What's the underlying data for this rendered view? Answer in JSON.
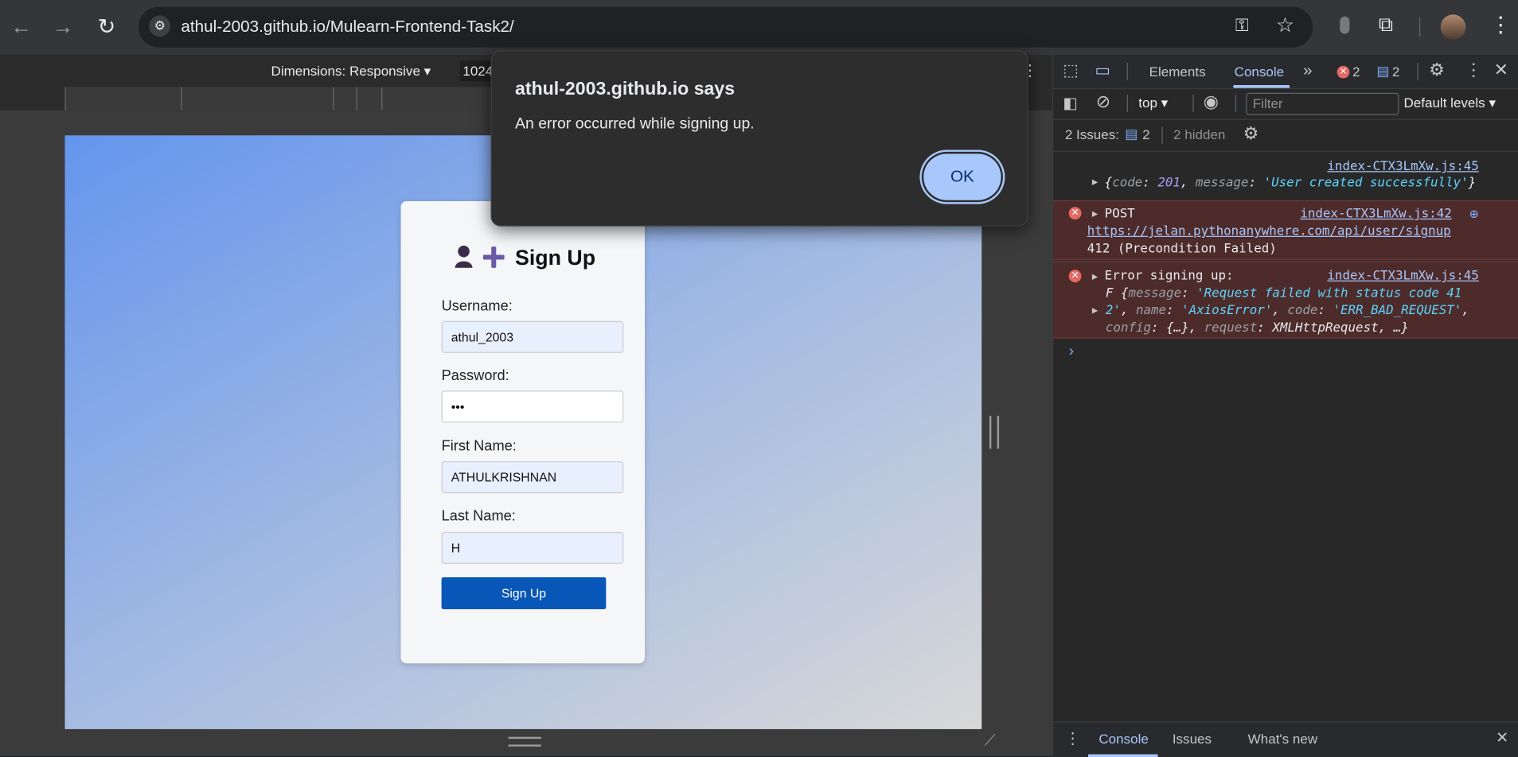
{
  "browser": {
    "url": "athul-2003.github.io/Mulearn-Frontend-Task2/"
  },
  "device_toolbar": {
    "dimensions_label": "Dimensions: Responsive",
    "width_value": "1024"
  },
  "signup": {
    "title": "Sign Up",
    "username_label": "Username:",
    "username_value": "athul_2003",
    "password_label": "Password:",
    "password_value": "•••",
    "firstname_label": "First Name:",
    "firstname_value": "ATHULKRISHNAN",
    "lastname_label": "Last Name:",
    "lastname_value": "H",
    "submit_label": "Sign Up"
  },
  "dialog": {
    "title": "athul-2003.github.io says",
    "message": "An error occurred while signing up.",
    "ok_label": "OK"
  },
  "devtools": {
    "tabs": {
      "elements": "Elements",
      "console": "Console"
    },
    "error_count": "2",
    "message_count": "2",
    "context": "top",
    "filter_placeholder": "Filter",
    "levels": "Default levels",
    "issues_label": "2 Issues:",
    "issues_count": "2",
    "hidden_label": "2 hidden",
    "log1": {
      "source": "index-CTX3LmXw.js:45",
      "text_open": "{",
      "k1": "code",
      "v1": "201",
      "k2": "message",
      "v2": "'User created successfully'",
      "text_close": "}"
    },
    "log2": {
      "source": "index-CTX3LmXw.js:42",
      "method": "POST",
      "url": "https://jelan.pythonanywhere.com/api/user/signup",
      "status": "412 (Precondition Failed)"
    },
    "log3": {
      "source": "index-CTX3LmXw.js:45",
      "title": "Error signing up:",
      "line1_a": "F {",
      "line1_k": "message",
      "line1_v": "'Request failed with status code 41",
      "line2_v": "2'",
      "line2_rest_k1": "name",
      "line2_rest_v1": "'AxiosError'",
      "line2_rest_k2": "code",
      "line2_rest_v2": "'ERR_BAD_REQUEST'",
      "line3_k1": "config",
      "line3_v1": "{…}",
      "line3_k2": "request",
      "line3_v2": "XMLHttpRequest, …}"
    },
    "bottom_tabs": {
      "console": "Console",
      "issues": "Issues",
      "whats_new": "What's new"
    }
  }
}
